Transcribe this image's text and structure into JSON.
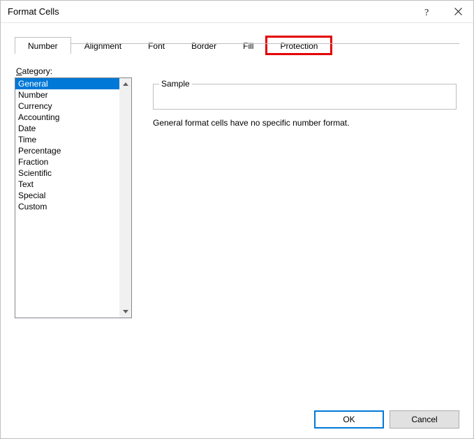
{
  "title": "Format Cells",
  "tabs": [
    {
      "label": "Number",
      "active": true
    },
    {
      "label": "Alignment"
    },
    {
      "label": "Font"
    },
    {
      "label": "Border"
    },
    {
      "label": "Fill"
    },
    {
      "label": "Protection",
      "highlight": true
    }
  ],
  "category": {
    "label_pre": "C",
    "label_post": "ategory:",
    "items": [
      "General",
      "Number",
      "Currency",
      "Accounting",
      "Date",
      "Time",
      "Percentage",
      "Fraction",
      "Scientific",
      "Text",
      "Special",
      "Custom"
    ],
    "selected": "General"
  },
  "sample": {
    "legend": "Sample",
    "value": ""
  },
  "description": "General format cells have no specific number format.",
  "buttons": {
    "ok": "OK",
    "cancel": "Cancel"
  }
}
